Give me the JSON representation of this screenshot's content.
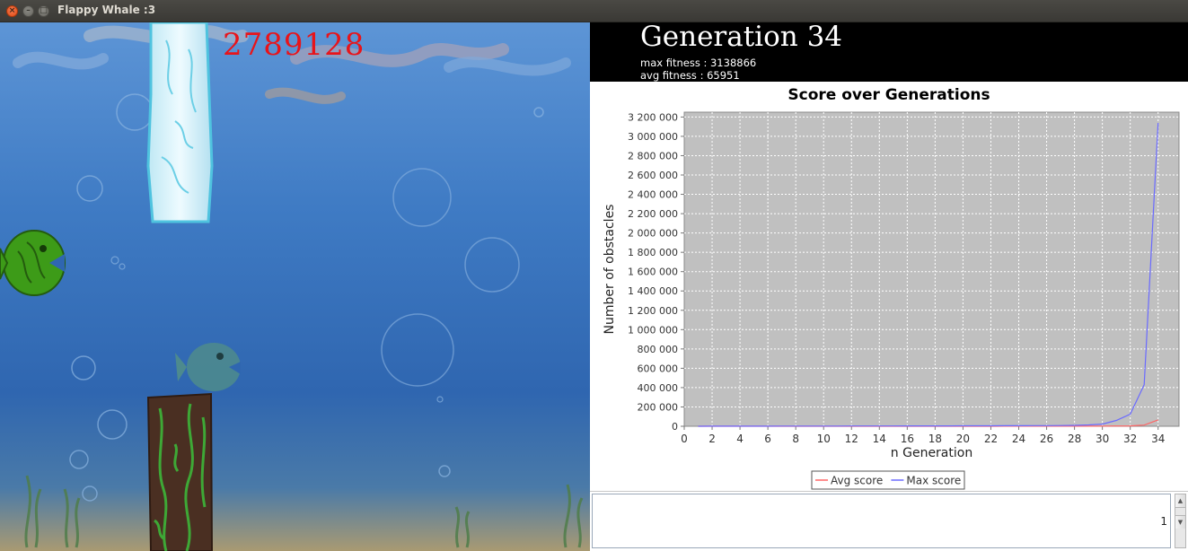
{
  "window": {
    "title": "Flappy Whale :3",
    "close_glyph": "×",
    "min_glyph": "–",
    "max_glyph": "□"
  },
  "game": {
    "score": "2789128"
  },
  "generation_panel": {
    "title": "Generation 34",
    "max_fitness": "max fitness : 3138866",
    "avg_fitness": "avg fitness : 65951"
  },
  "chart_data": {
    "type": "line",
    "title": "Score over Generations",
    "xlabel": "n Generation",
    "ylabel": "Number of obstacles",
    "xlim": [
      0,
      35.5
    ],
    "ylim": [
      0,
      3250000
    ],
    "xticks": [
      0,
      2,
      4,
      6,
      8,
      10,
      12,
      14,
      16,
      18,
      20,
      22,
      24,
      26,
      28,
      30,
      32,
      34
    ],
    "yticks": [
      0,
      200000,
      400000,
      600000,
      800000,
      1000000,
      1200000,
      1400000,
      1600000,
      1800000,
      2000000,
      2200000,
      2400000,
      2600000,
      2800000,
      3000000,
      3200000
    ],
    "ytick_labels": [
      "0",
      "200 000",
      "400 000",
      "600 000",
      "800 000",
      "1 000 000",
      "1 200 000",
      "1 400 000",
      "1 600 000",
      "1 800 000",
      "2 000 000",
      "2 200 000",
      "2 400 000",
      "2 600 000",
      "2 800 000",
      "3 000 000",
      "3 200 000"
    ],
    "x": [
      1,
      2,
      3,
      4,
      5,
      6,
      7,
      8,
      9,
      10,
      11,
      12,
      13,
      14,
      15,
      16,
      17,
      18,
      19,
      20,
      21,
      22,
      23,
      24,
      25,
      26,
      27,
      28,
      29,
      30,
      31,
      32,
      33,
      34
    ],
    "series": [
      {
        "name": "Avg score",
        "color": "#ff6666",
        "values": [
          20,
          30,
          40,
          50,
          60,
          70,
          80,
          90,
          100,
          110,
          130,
          150,
          170,
          190,
          210,
          240,
          270,
          300,
          330,
          360,
          400,
          450,
          500,
          560,
          620,
          700,
          800,
          1000,
          1300,
          1800,
          2500,
          4000,
          12000,
          65951
        ]
      },
      {
        "name": "Max score",
        "color": "#6a6aff",
        "values": [
          300,
          500,
          700,
          900,
          1100,
          1300,
          1500,
          1700,
          1900,
          2100,
          2300,
          2500,
          2700,
          2900,
          3100,
          3300,
          3500,
          3700,
          4000,
          4300,
          4600,
          5000,
          5400,
          5800,
          6300,
          6900,
          7600,
          9000,
          14000,
          22000,
          60000,
          125000,
          430000,
          3138866
        ]
      }
    ],
    "grid": true,
    "background": "#c0c0c0",
    "legend_placement": "bottom-center"
  },
  "console": {
    "line_number": "1"
  }
}
